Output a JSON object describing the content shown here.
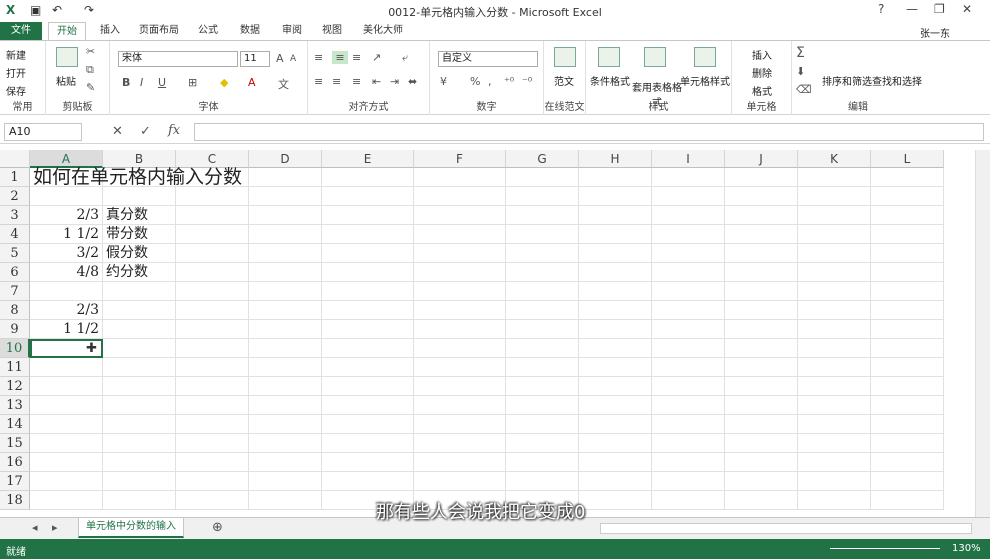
{
  "window": {
    "title": "0012-单元格内输入分数 - Microsoft Excel",
    "user": "张一东"
  },
  "tabs": [
    "文件",
    "开始",
    "插入",
    "页面布局",
    "公式",
    "数据",
    "审阅",
    "视图",
    "美化大师"
  ],
  "ribbon": {
    "clipboard": {
      "new": "新建",
      "open": "打开",
      "save": "保存",
      "common": "常用",
      "paste": "粘贴",
      "label": "剪贴板"
    },
    "font": {
      "name": "宋体",
      "size": "11",
      "label": "字体",
      "bold": "B",
      "italic": "I",
      "underline": "U"
    },
    "align": {
      "label": "对齐方式"
    },
    "number": {
      "format": "自定义",
      "label": "数字",
      "percent": "%",
      "comma": ","
    },
    "template": {
      "label": "在线范文",
      "btn": "范文"
    },
    "styles": {
      "cond": "条件格式",
      "table": "套用表格格式",
      "cell": "单元格样式",
      "label": "样式"
    },
    "cells": {
      "insert": "插入",
      "delete": "删除",
      "format": "格式",
      "label": "单元格"
    },
    "editing": {
      "sort": "排序和筛选",
      "find": "查找和选择",
      "label": "编辑"
    }
  },
  "formula_bar": {
    "name_box": "A10",
    "fx": "fx",
    "value": ""
  },
  "columns": [
    "A",
    "B",
    "C",
    "D",
    "E",
    "F",
    "G",
    "H",
    "I",
    "J",
    "K",
    "L"
  ],
  "rows": [
    "1",
    "2",
    "3",
    "4",
    "5",
    "6",
    "7",
    "8",
    "9",
    "10",
    "11",
    "12",
    "13",
    "14",
    "15",
    "16",
    "17",
    "18"
  ],
  "cells": {
    "A1": "如何在单元格内输入分数",
    "A3": "2/3",
    "B3": "真分数",
    "A4": "1 1/2",
    "B4": "带分数",
    "A5": "3/2",
    "B5": "假分数",
    "A6": "4/8",
    "B6": "约分数",
    "A8": "2/3",
    "A9": "1 1/2"
  },
  "sheet": {
    "tab": "单元格中分数的输入"
  },
  "caption": "那有些人会说我把它变成0",
  "status": {
    "ready": "就绪",
    "zoom": "130%"
  }
}
